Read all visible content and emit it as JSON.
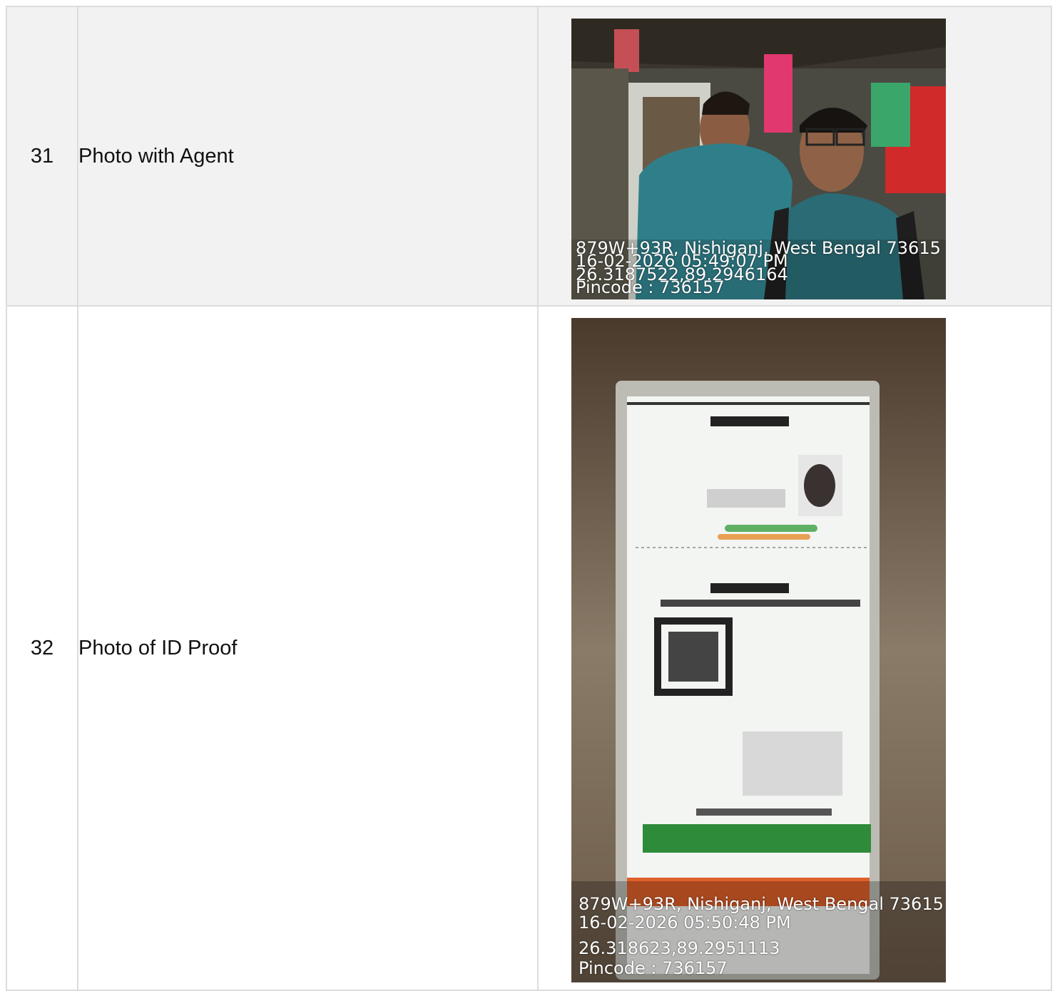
{
  "rows": [
    {
      "number": "31",
      "label": "Photo with Agent",
      "photo": {
        "address": "879W+93R, Nishiganj, West Bengal 73615",
        "datetime": "16-02-2026 05:49:07 PM",
        "coords": "26.3187522,89.2946164",
        "pincode": "Pincode : 736157"
      }
    },
    {
      "number": "32",
      "label": "Photo of ID Proof",
      "photo": {
        "address": "879W+93R, Nishiganj, West Bengal 73615",
        "datetime": "16-02-2026 05:50:48 PM",
        "coords": "26.318623,89.2951113",
        "pincode": "Pincode : 736157"
      }
    }
  ]
}
